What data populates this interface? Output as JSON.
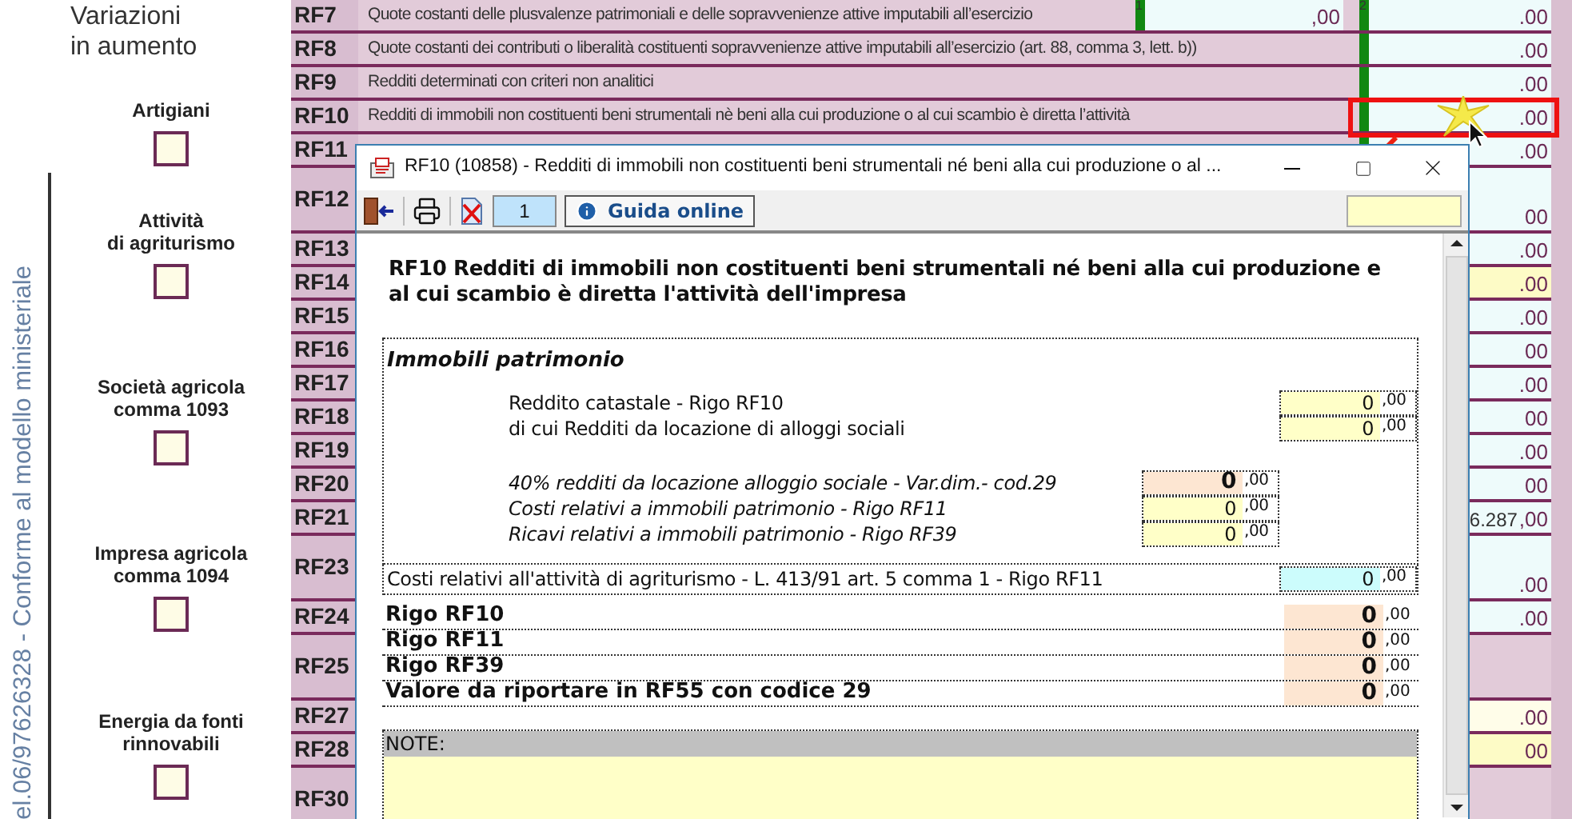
{
  "side_panel": {
    "vertical_text": "el.06/97626328 - Conforme al modello ministeriale",
    "section_title": "Variazioni\nin aumento",
    "options": [
      {
        "label": "Artigiani",
        "checked": false
      },
      {
        "label": "Attività\ndi agriturismo",
        "checked": false
      },
      {
        "label": "Società agricola\ncomma 1093",
        "checked": false
      },
      {
        "label": "Impresa agricola\ncomma 1094",
        "checked": false
      },
      {
        "label": "Energia da fonti\nrinnovabili",
        "checked": false
      }
    ]
  },
  "form_rows": [
    {
      "code": "RF7",
      "kind": "single",
      "description": "Quote costanti delle plusvalenze patrimoniali e delle sopravvenienze attive imputabili all’esercizio",
      "fields": [
        {
          "sup": "1",
          "decimals": ",00",
          "color": "#eefbfb",
          "marked": true
        },
        {
          "sup": "2",
          "decimals": ".00",
          "color": "#eefbfb",
          "marked": true
        }
      ]
    },
    {
      "code": "RF8",
      "kind": "single",
      "description": "Quote costanti dei contributi o liberalità costituenti sopravvenienze attive imputabili all’esercizio (art. 88, comma 3, lett. b))",
      "fields": [
        {
          "decimals": ".00",
          "color": "#eefbfb",
          "marked": true
        }
      ]
    },
    {
      "code": "RF9",
      "kind": "single",
      "description": "Redditi determinati con criteri non analitici",
      "fields": [
        {
          "decimals": ".00",
          "color": "#eefbfb",
          "marked": true
        }
      ]
    },
    {
      "code": "RF10",
      "kind": "single",
      "description": "Redditi di immobili non costituenti beni strumentali nè beni alla cui produzione o al cui scambio è diretta l’attività",
      "highlighted": true,
      "fields": [
        {
          "decimals": ".00",
          "color": "#eefbfb",
          "marked": true
        }
      ]
    },
    {
      "code": "RF11",
      "kind": "single",
      "fields": [
        {
          "decimals": ".00",
          "color": "#eefbfb",
          "marked": true
        }
      ]
    },
    {
      "code": "RF12",
      "kind": "tall",
      "fields": [
        {
          "decimals": "00",
          "color": "#eefbfb"
        }
      ]
    },
    {
      "code": "RF13",
      "kind": "single",
      "fields": [
        {
          "decimals": ".00",
          "color": "#eefbfb"
        }
      ]
    },
    {
      "code": "RF14",
      "kind": "single",
      "fields": [
        {
          "decimals": ".00",
          "color": "#fdfbc6"
        }
      ]
    },
    {
      "code": "RF15",
      "kind": "single",
      "fields": [
        {
          "decimals": ".00",
          "color": "#eefbfb"
        }
      ]
    },
    {
      "code": "RF16",
      "kind": "single",
      "fields": [
        {
          "decimals": "00",
          "color": "#eefbfb"
        }
      ]
    },
    {
      "code": "RF17",
      "kind": "single",
      "fields": [
        {
          "decimals": ".00",
          "color": "#eefbfb"
        }
      ]
    },
    {
      "code": "RF18",
      "kind": "single",
      "fields": [
        {
          "decimals": "00",
          "color": "#eefbfb"
        }
      ]
    },
    {
      "code": "RF19",
      "kind": "single",
      "fields": [
        {
          "decimals": ".00",
          "color": "#eefbfb"
        }
      ]
    },
    {
      "code": "RF20",
      "kind": "single",
      "fields": [
        {
          "decimals": "00",
          "color": "#eefbfb"
        }
      ]
    },
    {
      "code": "RF21",
      "kind": "single",
      "fields": [
        {
          "value": "6.287",
          "decimals": ",00",
          "color": "#eefbfb"
        }
      ]
    },
    {
      "code": "RF23",
      "kind": "tall",
      "fields": [
        {
          "decimals": ".00",
          "color": "#eefbfb"
        }
      ]
    },
    {
      "code": "RF24",
      "kind": "single",
      "fields": [
        {
          "decimals": ".00",
          "color": "#eefbfb"
        }
      ]
    },
    {
      "code": "RF25",
      "kind": "tall",
      "fields": []
    },
    {
      "code": "RF27",
      "kind": "single",
      "fields": [
        {
          "decimals": ".00",
          "color": "#fffde9"
        }
      ]
    },
    {
      "code": "RF28",
      "kind": "single",
      "fields": [
        {
          "decimals": "00",
          "color": "#fdfbc6"
        }
      ]
    },
    {
      "code": "RF30",
      "kind": "tall",
      "fields": []
    }
  ],
  "dialog": {
    "title": "RF10 (10858) - Redditi di immobili non costituenti beni strumentali né beni alla cui produzione o al ...",
    "page": "1",
    "help_button": "Guida online",
    "heading": "RF10 Redditi di immobili non costituenti beni strumentali né beni alla cui produzione e al cui scambio è diretta l'attività dell'impresa",
    "section_title": "Immobili patrimonio",
    "lines": [
      {
        "kind": "outer",
        "label": "Reddito catastale - Rigo RF10",
        "value": "0",
        "decimals": ",00",
        "color": "#ffffc8"
      },
      {
        "kind": "outer",
        "label": "di cui Redditi da locazione di alloggi sociali",
        "value": "0",
        "decimals": ",00",
        "color": "#ffffc8"
      },
      {
        "kind": "inner-result",
        "label": "40% redditi da locazione alloggio sociale - Var.dim.- cod.29",
        "value": "0",
        "decimals": ",00",
        "color": "#fde6d2"
      },
      {
        "kind": "inner-input",
        "label": "Costi relativi a immobili patrimonio - Rigo RF11",
        "value": "0",
        "decimals": ",00",
        "color": "#ffffc8"
      },
      {
        "kind": "inner-input",
        "label": "Ricavi relativi a immobili patrimonio - Rigo RF39",
        "value": "0",
        "decimals": ",00",
        "color": "#ffffc8"
      }
    ],
    "agri_line": {
      "label": "Costi relativi all'attività di agriturismo - L. 413/91 art. 5 comma 1 - Rigo RF11",
      "value": "0",
      "decimals": ",00",
      "color": "#ccfcfc"
    },
    "totals": [
      {
        "label": "Rigo RF10",
        "value": "0",
        "decimals": ",00",
        "color": "#fde6d2"
      },
      {
        "label": "Rigo RF11",
        "value": "0",
        "decimals": ",00",
        "color": "#fde6d2"
      },
      {
        "label": "Rigo RF39",
        "value": "0",
        "decimals": ",00",
        "color": "#fde6d2"
      },
      {
        "label": "Valore da riportare in RF55 con codice 29",
        "value": "0",
        "decimals": ",00",
        "color": "#fde6d2"
      }
    ],
    "note_label": "NOTE:"
  }
}
